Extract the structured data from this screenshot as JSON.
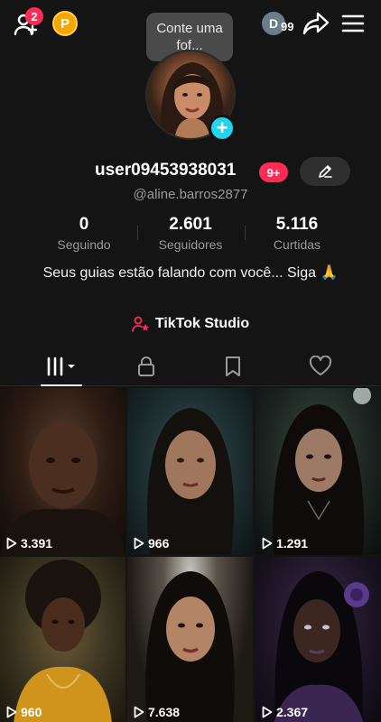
{
  "header": {
    "notifications_badge": "2",
    "coin_letter": "P",
    "tooltip": "Conte uma fof...",
    "account_initial": "D",
    "account_count": "99"
  },
  "profile": {
    "username": "user09453938031",
    "badge": "9+",
    "handle": "@aline.barros2877",
    "bio": "Seus guias estão falando com você... Siga 🙏",
    "studio_label": "TikTok Studio"
  },
  "stats": [
    {
      "value": "0",
      "label": "Seguindo"
    },
    {
      "value": "2.601",
      "label": "Seguidores"
    },
    {
      "value": "5.116",
      "label": "Curtidas"
    }
  ],
  "tabs": [
    "videos-tab",
    "private-tab",
    "saved-tab",
    "liked-tab"
  ],
  "videos": [
    {
      "views": "3.391",
      "bg": "#3a2a20"
    },
    {
      "views": "966",
      "bg": "#1f3a3e"
    },
    {
      "views": "1.291",
      "bg": "#22302b"
    },
    {
      "views": "960",
      "bg": "#4a3a20"
    },
    {
      "views": "7.638",
      "bg": "#2b2622"
    },
    {
      "views": "2.367",
      "bg": "#2a1f33"
    }
  ],
  "colors": {
    "accent_red": "#fe2c55",
    "accent_cyan": "#20d5ec",
    "background": "#141414"
  }
}
